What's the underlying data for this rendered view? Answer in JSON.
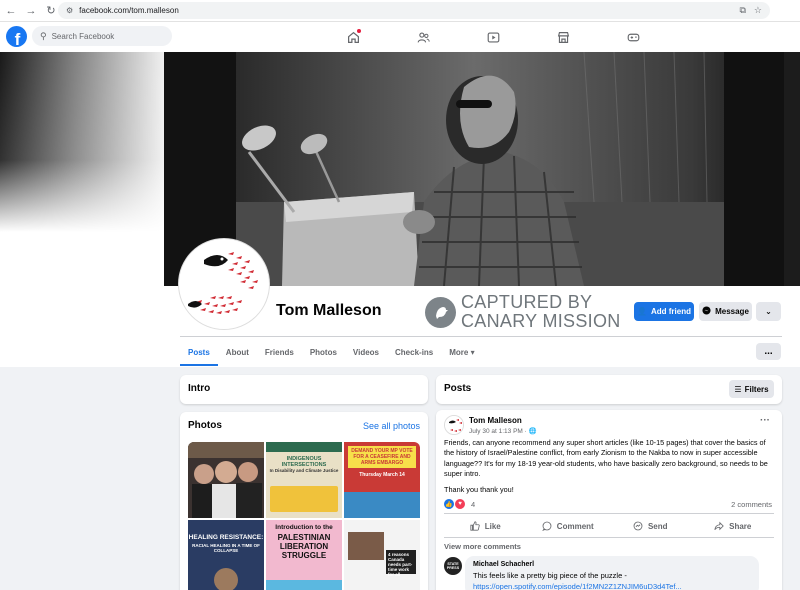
{
  "browser": {
    "url": "facebook.com/tom.malleson"
  },
  "nav": {
    "search_placeholder": "Search Facebook",
    "logo_letter": "f"
  },
  "profile": {
    "name": "Tom Malleson",
    "overlay_line1": "CAPTURED BY",
    "overlay_line2": "CANARY MISSION",
    "add_friend": "Add friend",
    "message": "Message",
    "more_chevron": "⌄"
  },
  "tabs": [
    "Posts",
    "About",
    "Friends",
    "Photos",
    "Videos",
    "Check-ins",
    "More ▾"
  ],
  "tab_dots": "...",
  "intro": {
    "title": "Intro"
  },
  "photos": {
    "title": "Photos",
    "see_all": "See all photos",
    "captions": {
      "p2_title": "INDIGENOUS INTERSECTIONS",
      "p2_sub": "In Disability and Climate Justice",
      "p3_title": "DEMAND YOUR MP VOTE FOR A CEASEFIRE AND ARMS EMBARGO",
      "p3_date": "Thursday March 14",
      "p4_title": "HEALING RESISTANCE:",
      "p4_sub": "RACIAL HEALING IN A TIME OF COLLAPSE",
      "p5_line1": "Introduction to the",
      "p5_line2": "PALESTINIAN LIBERATION STRUGGLE",
      "p6_text": "4 reasons Canada needs part-time work for all"
    }
  },
  "posts_header": {
    "title": "Posts",
    "filters": "Filters"
  },
  "post": {
    "author": "Tom Malleson",
    "date": "July 30 at 1:13 PM · ",
    "menu": "···",
    "body": "Friends, can anyone recommend any super short articles (like 10-15 pages) that cover the basics of the history of Israel/Palestine conflict, from early Zionism to the Nakba to now in super accessible language?? It's for my 18-19 year-old students, who have basically zero background, so needs to be super intro.",
    "thanks": "Thank you thank you!",
    "reaction_count": "4",
    "comments_count": "2 comments",
    "actions": {
      "like": "Like",
      "comment": "Comment",
      "send": "Send",
      "share": "Share"
    },
    "view_more": "View more comments",
    "comment": {
      "avatar_text": "STATE PRESS",
      "author": "Michael Schacherl",
      "text": "This feels like a pretty big piece of the puzzle -",
      "link": "https://open.spotify.com/episode/1f2MN2Z1ZNJIM6uD3d4Tef..."
    }
  },
  "colors": {
    "fb_blue": "#1877f2",
    "button_blue": "#1b74e4",
    "canary_gray": "#6f767b"
  }
}
